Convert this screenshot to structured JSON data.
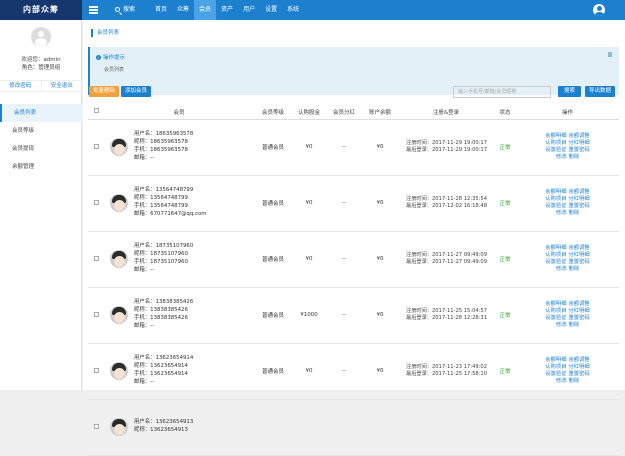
{
  "app": {
    "brand": "内部众筹"
  },
  "topbar": {
    "search_label": "搜索",
    "nav": [
      "首页",
      "众筹",
      "会员",
      "资产",
      "用户",
      "设置",
      "系统"
    ],
    "active_nav": "会员"
  },
  "sidebar": {
    "welcome": "欢迎您：admin",
    "role": "角色：管理员组",
    "change_pwd": "修改密码",
    "logout": "安全退出",
    "menu": [
      "会员列表",
      "会员等级",
      "会员提现",
      "余额管理"
    ]
  },
  "main": {
    "breadcrumb": "会员列表",
    "hint_title": "操作提示",
    "hint_text": "会员列表",
    "batch_delete": "批量删除",
    "add_member": "添加会员",
    "search_placeholder": "输入手机号/邮箱/会员昵称",
    "search_btn": "搜索",
    "export_btn": "导出数据",
    "columns": [
      "会员",
      "会员等级",
      "认购股金",
      "会员分红",
      "账户余额",
      "注册&登录",
      "状态",
      "操作"
    ],
    "op_labels": [
      "余额明细",
      "余额调整",
      "认购项目",
      "分红明细",
      "设置验证",
      "重置密码",
      "修改",
      "删除"
    ],
    "rows": [
      {
        "username": "用户名：18635963578",
        "nickname": "昵称：18635963578",
        "phone": "手机：18635963578",
        "email": "邮箱：--",
        "level": "普通会员",
        "stake": "¥0",
        "dividend": "--",
        "balance": "¥0",
        "reg": "注册时间：2017-11-29 19:00:17",
        "login": "最后登录：2017-11-29 19:00:17",
        "status": "正常"
      },
      {
        "username": "用户名：13564748799",
        "nickname": "昵称：13564748799",
        "phone": "手机：13564748799",
        "email": "邮箱：670771647@qq.com",
        "level": "普通会员",
        "stake": "¥0",
        "dividend": "--",
        "balance": "¥0",
        "reg": "注册时间：2017-11-28 12:35:54",
        "login": "最后登录：2017-12-02 16:18:48",
        "status": "正常"
      },
      {
        "username": "用户名：18735107960",
        "nickname": "昵称：18735107960",
        "phone": "手机：18735107960",
        "email": "邮箱：--",
        "level": "普通会员",
        "stake": "¥0",
        "dividend": "--",
        "balance": "¥0",
        "reg": "注册时间：2017-11-27 09:49:09",
        "login": "最后登录：2017-11-27 09:49:09",
        "status": "正常"
      },
      {
        "username": "用户名：13838385426",
        "nickname": "昵称：13838385426",
        "phone": "手机：13838385426",
        "email": "邮箱：--",
        "level": "普通会员",
        "stake": "¥1000",
        "dividend": "--",
        "balance": "¥0",
        "reg": "注册时间：2017-11-25 15:04:57",
        "login": "最后登录：2017-11-28 12:28:31",
        "status": "正常"
      },
      {
        "username": "用户名：13623654914",
        "nickname": "昵称：13623654914",
        "phone": "手机：13623654914",
        "email": "邮箱：--",
        "level": "普通会员",
        "stake": "¥0",
        "dividend": "--",
        "balance": "¥0",
        "reg": "注册时间：2017-11-23 17:49:02",
        "login": "最后登录：2017-11-25 17:58:10",
        "status": "正常"
      },
      {
        "username": "用户名：13623654913",
        "nickname": "昵称：13623654913",
        "phone": "",
        "email": "",
        "level": "",
        "stake": "",
        "dividend": "",
        "balance": "",
        "reg": "",
        "login": "",
        "status": ""
      }
    ]
  }
}
